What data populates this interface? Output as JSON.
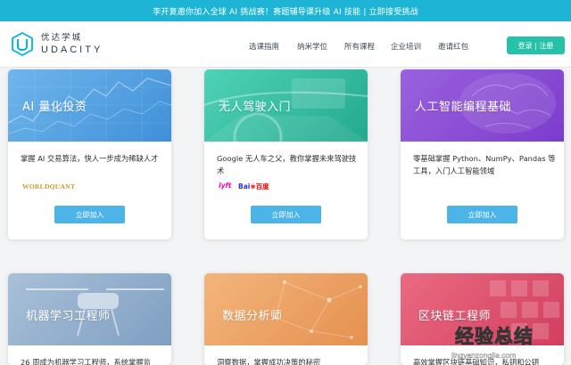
{
  "banner": {
    "text": "李开复邀你加入全球 AI 挑战赛！赛题辅导课升级 AI 技能 | 立即接受挑战"
  },
  "logo": {
    "cn": "优达学城",
    "en": "UDACITY"
  },
  "nav": {
    "items": [
      "选课指南",
      "纳米学位",
      "所有课程",
      "企业培训",
      "邀请红包"
    ],
    "login": "登录 | 注册"
  },
  "courses": [
    {
      "title": "AI 量化投资",
      "desc": "掌握 AI 交易算法，快人一步成为稀缺人才",
      "partners": [
        "WORLDQUANT"
      ],
      "button": "立即加入",
      "color": "#55a7e6"
    },
    {
      "title": "无人驾驶入门",
      "desc": "Google 无人车之父，教你掌握未来驾驶技术",
      "partners": [
        "lyft",
        "Bai",
        "百度"
      ],
      "button": "立即加入",
      "color": "#2ec3a5"
    },
    {
      "title": "人工智能编程基础",
      "desc": "零基础掌握 Python、NumPy、Pandas 等工具，入门人工智能领域",
      "partners": [],
      "button": "立即加入",
      "color": "#8f52d6"
    },
    {
      "title": "机器学习工程师",
      "desc": "26 周成为机器学习工程师，系统掌握监",
      "partners": [],
      "button": "",
      "color": "#8faecc"
    },
    {
      "title": "数据分析师",
      "desc": "洞察数据，掌握成功决策的秘密",
      "partners": [],
      "button": "",
      "color": "#eda66c"
    },
    {
      "title": "区块链工程师",
      "desc": "高效掌握区块链基础知识，私钥和公钥",
      "partners": [],
      "button": "",
      "color": "#e2556e"
    }
  ],
  "watermark": {
    "cn": "经验总结",
    "url": "jingyanzongjie.com"
  }
}
